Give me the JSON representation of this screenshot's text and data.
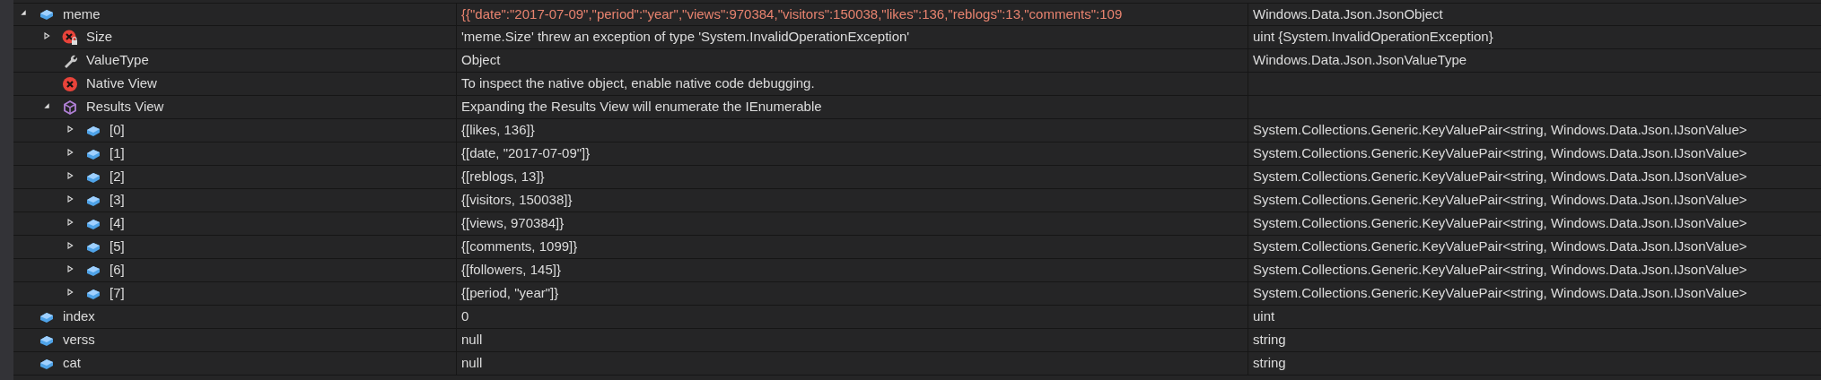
{
  "watch_rows": [
    {
      "name": "meme",
      "value": "{{\"date\":\"2017-07-09\",\"period\":\"year\",\"views\":970384,\"visitors\":150038,\"likes\":136,\"reblogs\":13,\"comments\":109",
      "type": "Windows.Data.Json.JsonObject",
      "kind": "object",
      "expanded": true,
      "changed": true,
      "children": [
        {
          "name": "Size",
          "value": "'meme.Size' threw an exception of type 'System.InvalidOperationException'",
          "type": "uint {System.InvalidOperationException}",
          "kind": "error-lock",
          "expanded": false,
          "changed": false
        },
        {
          "name": "ValueType",
          "value": "Object",
          "type": "Windows.Data.Json.JsonValueType",
          "kind": "wrench",
          "changed": false
        },
        {
          "name": "Native View",
          "value": "To inspect the native object, enable native code debugging.",
          "kind": "error",
          "changed": false
        },
        {
          "name": "Results View",
          "value": "Expanding the Results View will enumerate the IEnumerable",
          "kind": "results",
          "expanded": true,
          "changed": false,
          "children": [
            {
              "name": "[0]",
              "value": "{[likes, 136]}",
              "type": "System.Collections.Generic.KeyValuePair<string, Windows.Data.Json.IJsonValue>",
              "kind": "object",
              "expanded": false,
              "changed": false
            },
            {
              "name": "[1]",
              "value": "{[date, \"2017-07-09\"]}",
              "type": "System.Collections.Generic.KeyValuePair<string, Windows.Data.Json.IJsonValue>",
              "kind": "object",
              "expanded": false,
              "changed": false
            },
            {
              "name": "[2]",
              "value": "{[reblogs, 13]}",
              "type": "System.Collections.Generic.KeyValuePair<string, Windows.Data.Json.IJsonValue>",
              "kind": "object",
              "expanded": false,
              "changed": false
            },
            {
              "name": "[3]",
              "value": "{[visitors, 150038]}",
              "type": "System.Collections.Generic.KeyValuePair<string, Windows.Data.Json.IJsonValue>",
              "kind": "object",
              "expanded": false,
              "changed": false
            },
            {
              "name": "[4]",
              "value": "{[views, 970384]}",
              "type": "System.Collections.Generic.KeyValuePair<string, Windows.Data.Json.IJsonValue>",
              "kind": "object",
              "expanded": false,
              "changed": false
            },
            {
              "name": "[5]",
              "value": "{[comments, 1099]}",
              "type": "System.Collections.Generic.KeyValuePair<string, Windows.Data.Json.IJsonValue>",
              "kind": "object",
              "expanded": false,
              "changed": false
            },
            {
              "name": "[6]",
              "value": "{[followers, 145]}",
              "type": "System.Collections.Generic.KeyValuePair<string, Windows.Data.Json.IJsonValue>",
              "kind": "object",
              "expanded": false,
              "changed": false
            },
            {
              "name": "[7]",
              "value": "{[period, \"year\"]}",
              "type": "System.Collections.Generic.KeyValuePair<string, Windows.Data.Json.IJsonValue>",
              "kind": "object",
              "expanded": false,
              "changed": false
            }
          ]
        }
      ]
    },
    {
      "name": "index",
      "value": "0",
      "type": "uint",
      "kind": "object",
      "changed": false
    },
    {
      "name": "verss",
      "value": "null",
      "type": "string",
      "kind": "object",
      "changed": false
    },
    {
      "name": "cat",
      "value": "null",
      "type": "string",
      "kind": "object",
      "changed": false
    }
  ]
}
